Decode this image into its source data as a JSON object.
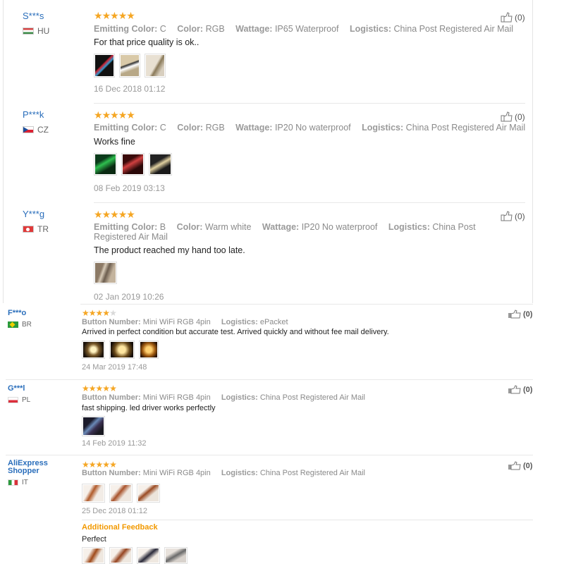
{
  "reviews": [
    {
      "user": "S***s",
      "country": "HU",
      "stars": 5,
      "attrs": [
        {
          "label": "Emitting Color:",
          "value": "C"
        },
        {
          "label": "Color:",
          "value": "RGB"
        },
        {
          "label": "Wattage:",
          "value": "IP65 Waterproof"
        },
        {
          "label": "Logistics:",
          "value": "China Post Registered Air Mail"
        }
      ],
      "text": "For that price quality is ok..",
      "date": "16 Dec 2018 01:12",
      "helpful": "(0)"
    },
    {
      "user": "P***k",
      "country": "CZ",
      "stars": 5,
      "attrs": [
        {
          "label": "Emitting Color:",
          "value": "C"
        },
        {
          "label": "Color:",
          "value": "RGB"
        },
        {
          "label": "Wattage:",
          "value": "IP20 No waterproof"
        },
        {
          "label": "Logistics:",
          "value": "China Post Registered Air Mail"
        }
      ],
      "text": "Works fine",
      "date": "08 Feb 2019 03:13",
      "helpful": "(0)"
    },
    {
      "user": "Y***g",
      "country": "TR",
      "stars": 5,
      "attrs": [
        {
          "label": "Emitting Color:",
          "value": "B"
        },
        {
          "label": "Color:",
          "value": "Warm white"
        },
        {
          "label": "Wattage:",
          "value": "IP20 No waterproof"
        },
        {
          "label": "Logistics:",
          "value": "China Post Registered Air Mail"
        }
      ],
      "text": "The product reached my hand too late.",
      "date": "02 Jan 2019 10:26",
      "helpful": "(0)"
    },
    {
      "user": "F***o",
      "country": "BR",
      "stars": 4,
      "attrs": [
        {
          "label": "Button Number:",
          "value": "Mini WiFi RGB 4pin"
        },
        {
          "label": "Logistics:",
          "value": "ePacket"
        }
      ],
      "text": "Arrived in perfect condition but accurate test. Arrived quickly and without fee mail delivery.",
      "date": "24 Mar 2019 17:48",
      "helpful": "(0)"
    },
    {
      "user": "G***l",
      "country": "PL",
      "stars": 5,
      "attrs": [
        {
          "label": "Button Number:",
          "value": "Mini WiFi RGB 4pin"
        },
        {
          "label": "Logistics:",
          "value": "China Post Registered Air Mail"
        }
      ],
      "text": "fast shipping. led driver works perfectly",
      "date": "14 Feb 2019 11:32",
      "helpful": "(0)"
    },
    {
      "user": "AliExpress Shopper",
      "country": "IT",
      "stars": 5,
      "attrs": [
        {
          "label": "Button Number:",
          "value": "Mini WiFi RGB 4pin"
        },
        {
          "label": "Logistics:",
          "value": "China Post Registered Air Mail"
        }
      ],
      "text": "",
      "date": "25 Dec 2018 01:12",
      "helpful": "(0)",
      "additional_feedback_label": "Additional Feedback",
      "additional_feedback_text": "Perfect"
    }
  ],
  "colors": {
    "star": "#f5a623",
    "username": "#2a6ebb",
    "additional_feedback": "#f29900"
  },
  "icons": {
    "helpful": "thumbs-up-icon"
  }
}
